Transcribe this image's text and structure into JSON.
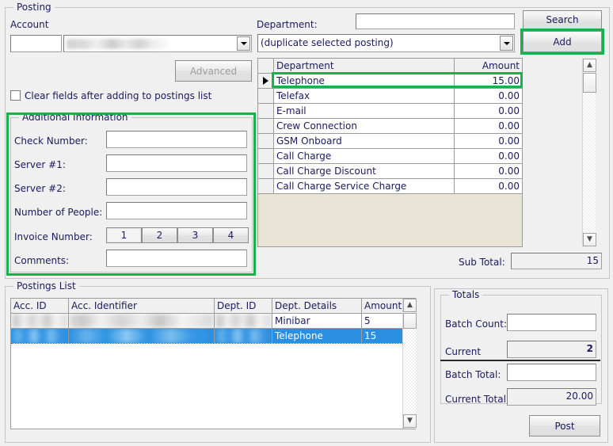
{
  "window": {
    "background_color": "#f0f0f0",
    "accent_highlight_color": "#18b24b",
    "selection_color": "#2a8fe0",
    "grid_empty_color": "#e9e5d6"
  },
  "posting_group": {
    "title": "Posting",
    "account_label": "Account",
    "account_id_value": "",
    "account_id_placeholder": "",
    "account_name_value": "",
    "account_name_redacted": true,
    "combo_caret_icon": "chevron-down-icon",
    "advanced_button": "Advanced",
    "advanced_disabled": true,
    "clear_fields_checkbox_label": "Clear fields after adding to postings list",
    "clear_fields_checked": false,
    "department_label": "Department:",
    "department_search_value": "",
    "department_combo_value": "(duplicate selected posting)",
    "search_button": "Search",
    "add_button": "Add",
    "sub_total_label": "Sub Total:",
    "sub_total_value": "15"
  },
  "department_grid": {
    "columns": [
      "",
      "Department",
      "Amount"
    ],
    "selected_row_index": 0,
    "row_indicator_icon": "triangle-right-icon",
    "rows": [
      {
        "department": "Telephone",
        "amount": "15.00"
      },
      {
        "department": "Telefax",
        "amount": "0.00"
      },
      {
        "department": "E-mail",
        "amount": "0.00"
      },
      {
        "department": "Crew Connection",
        "amount": "0.00"
      },
      {
        "department": "GSM Onboard",
        "amount": "0.00"
      },
      {
        "department": "Call Charge",
        "amount": "0.00"
      },
      {
        "department": "Call Charge Discount",
        "amount": "0.00"
      },
      {
        "department": "Call Charge Service Charge",
        "amount": "0.00"
      }
    ],
    "scroll_up_icon": "chevron-up-icon",
    "scroll_down_icon": "chevron-down-icon"
  },
  "additional_information": {
    "title": "Additional Information",
    "highlighted": true,
    "fields": [
      {
        "label": "Check Number:",
        "value": ""
      },
      {
        "label": "Server #1:",
        "value": ""
      },
      {
        "label": "Server #2:",
        "value": ""
      },
      {
        "label": "Number of People:",
        "value": ""
      }
    ],
    "invoice_number_label": "Invoice Number:",
    "invoice_number_buttons": [
      "1",
      "2",
      "3",
      "4"
    ],
    "invoice_number_selected": "1",
    "comments_label": "Comments:",
    "comments_value": ""
  },
  "postings_list": {
    "title": "Postings List",
    "columns": [
      "Acc. ID",
      "Acc. Identifier",
      "Dept. ID",
      "Dept. Details",
      "Amount"
    ],
    "rows": [
      {
        "acc_id": "",
        "acc_identifier": "",
        "dept_id": "",
        "dept_details": "Minibar",
        "amount": "5",
        "redacted": true,
        "selected": false
      },
      {
        "acc_id": "",
        "acc_identifier": "",
        "dept_id": "",
        "dept_details": "Telephone",
        "amount": "15",
        "redacted": true,
        "selected": true
      }
    ],
    "scroll_up_icon": "chevron-up-icon",
    "scroll_down_icon": "chevron-down-icon"
  },
  "totals": {
    "title": "Totals",
    "batch_count_label": "Batch Count:",
    "batch_count_value": "",
    "current_label": "Current",
    "current_value": "2",
    "batch_total_label": "Batch Total:",
    "batch_total_value": "",
    "current_total_label": "Current Total:",
    "current_total_value": "20.00",
    "post_button": "Post"
  }
}
